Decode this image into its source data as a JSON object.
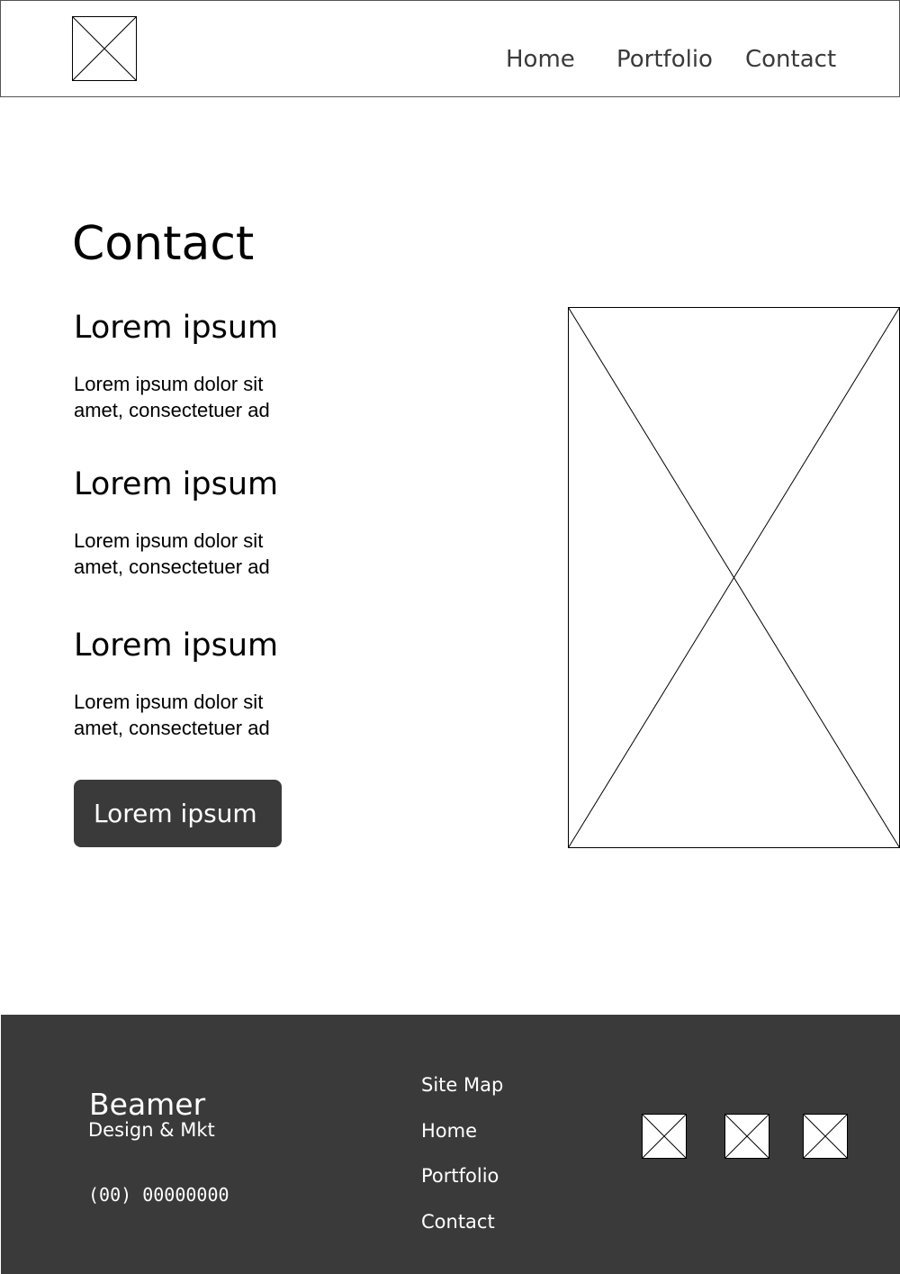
{
  "header": {
    "logo_icon": "image-placeholder-icon",
    "nav": [
      {
        "label": "Home"
      },
      {
        "label": "Portfolio"
      },
      {
        "label": "Contact"
      }
    ]
  },
  "main": {
    "title": "Contact",
    "sections": [
      {
        "heading": "Lorem ipsum",
        "text_line1": "Lorem ipsum dolor sit",
        "text_line2": "amet, consectetuer ad"
      },
      {
        "heading": "Lorem ipsum",
        "text_line1": "Lorem ipsum dolor sit",
        "text_line2": "amet, consectetuer ad"
      },
      {
        "heading": "Lorem ipsum",
        "text_line1": "Lorem ipsum dolor sit",
        "text_line2": "amet, consectetuer ad"
      }
    ],
    "button_label": "Lorem ipsum",
    "image_icon": "image-placeholder-icon"
  },
  "footer": {
    "brand_name": "Beamer",
    "brand_tagline": "Design & Mkt",
    "phone": "(00) 00000000",
    "sitemap_title": "Site  Map",
    "links": [
      {
        "label": "Home"
      },
      {
        "label": "Portfolio"
      },
      {
        "label": "Contact"
      }
    ],
    "social_icons": [
      "image-placeholder-icon",
      "image-placeholder-icon",
      "image-placeholder-icon"
    ]
  },
  "colors": {
    "footer_bg": "#3a3a3a",
    "button_bg": "#3a3a3a",
    "nav_text": "#3a3a3a",
    "placeholder_stroke": "#000000",
    "background": "#ffffff"
  }
}
